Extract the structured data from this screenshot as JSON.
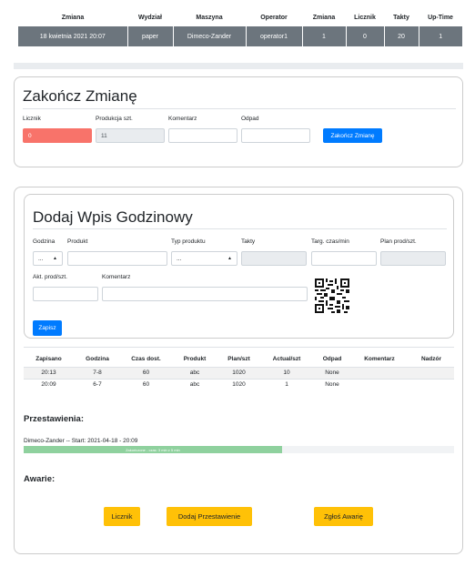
{
  "shift_table": {
    "headers": [
      "Zmiana",
      "Wydział",
      "Maszyna",
      "Operator",
      "Zmiana",
      "Licznik",
      "Takty",
      "Up-Time"
    ],
    "row": [
      "18 kwietnia 2021 20:07",
      "paper",
      "Dimeco-Zander",
      "operator1",
      "1",
      "0",
      "20",
      "1"
    ]
  },
  "end_shift": {
    "title": "Zakończ Zmianę",
    "counter_label": "Licznik",
    "counter_value": "0",
    "production_label": "Produkcja szt.",
    "production_value": "11",
    "comment_label": "Komentarz",
    "comment_value": "",
    "waste_label": "Odpad",
    "waste_value": "",
    "submit_label": "Zakończ Zmianę"
  },
  "hourly": {
    "title": "Dodaj Wpis Godzinowy",
    "hour_label": "Godzina",
    "hour_value": "...",
    "product_label": "Produkt",
    "product_type_label": "Typ produktu",
    "product_type_value": "...",
    "takty_label": "Takty",
    "target_label": "Targ. czas/min",
    "plan_label": "Plan prod/szt.",
    "actual_label": "Akt. prod/szt.",
    "comment_label": "Komentarz",
    "save_label": "Zapisz"
  },
  "log_table": {
    "headers": [
      "Zapisano",
      "Godzina",
      "Czas dost.",
      "Produkt",
      "Plan/szt",
      "Actual/szt",
      "Odpad",
      "Komentarz",
      "Nadzór"
    ],
    "rows": [
      [
        "20:13",
        "7-8",
        "60",
        "abc",
        "1020",
        "10",
        "None",
        "",
        ""
      ],
      [
        "20:09",
        "6-7",
        "60",
        "abc",
        "1020",
        "1",
        "None",
        "",
        ""
      ]
    ]
  },
  "changeovers": {
    "title": "Przestawienia:",
    "entry": "Dimeco-Zander -- Start: 2021-04-18 - 20:09",
    "progress_label": "Zakończone - czas: 3 min z 5 min",
    "progress_fraction": 0.6,
    "progress_color": "#8fd19e"
  },
  "failures": {
    "title": "Awarie:"
  },
  "actions": {
    "counter_label": "Licznik",
    "add_changeover_label": "Dodaj Przestawienie",
    "report_failure_label": "Zgłoś Awarię"
  },
  "icons": {
    "select_arrow": "updown-arrow-icon",
    "qr": "qr-code-icon"
  },
  "colors": {
    "primary": "#007bff",
    "warning": "#ffc107",
    "danger_input": "#f8736a",
    "header_row": "#6c757d"
  }
}
